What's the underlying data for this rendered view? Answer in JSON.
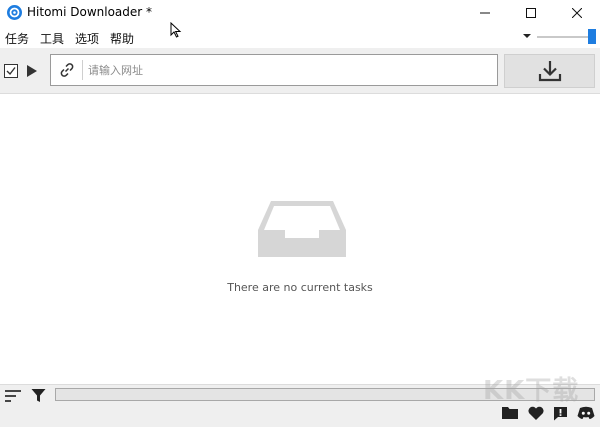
{
  "window": {
    "title": "Hitomi Downloader *",
    "controls": {
      "minimize": "—",
      "maximize": "☐",
      "close": "✕"
    }
  },
  "menu": [
    "任务",
    "工具",
    "选项",
    "帮助"
  ],
  "toolbar": {
    "url_placeholder": "请输入网址",
    "url_value": "",
    "icons": [
      "check-all-icon",
      "play-icon",
      "link-icon",
      "download-icon"
    ]
  },
  "slider": {
    "value_fraction": 1.0
  },
  "main": {
    "empty_message": "There are no current tasks"
  },
  "bottom": {
    "icons": [
      "sort-icon",
      "filter-icon",
      "folder-icon",
      "heart-icon",
      "alert-icon",
      "discord-icon"
    ]
  },
  "watermark": "KK下载",
  "colors": {
    "accent": "#1e7de0",
    "toolbar_bg": "#efefef",
    "inbox_gray": "#d6d6d6"
  }
}
